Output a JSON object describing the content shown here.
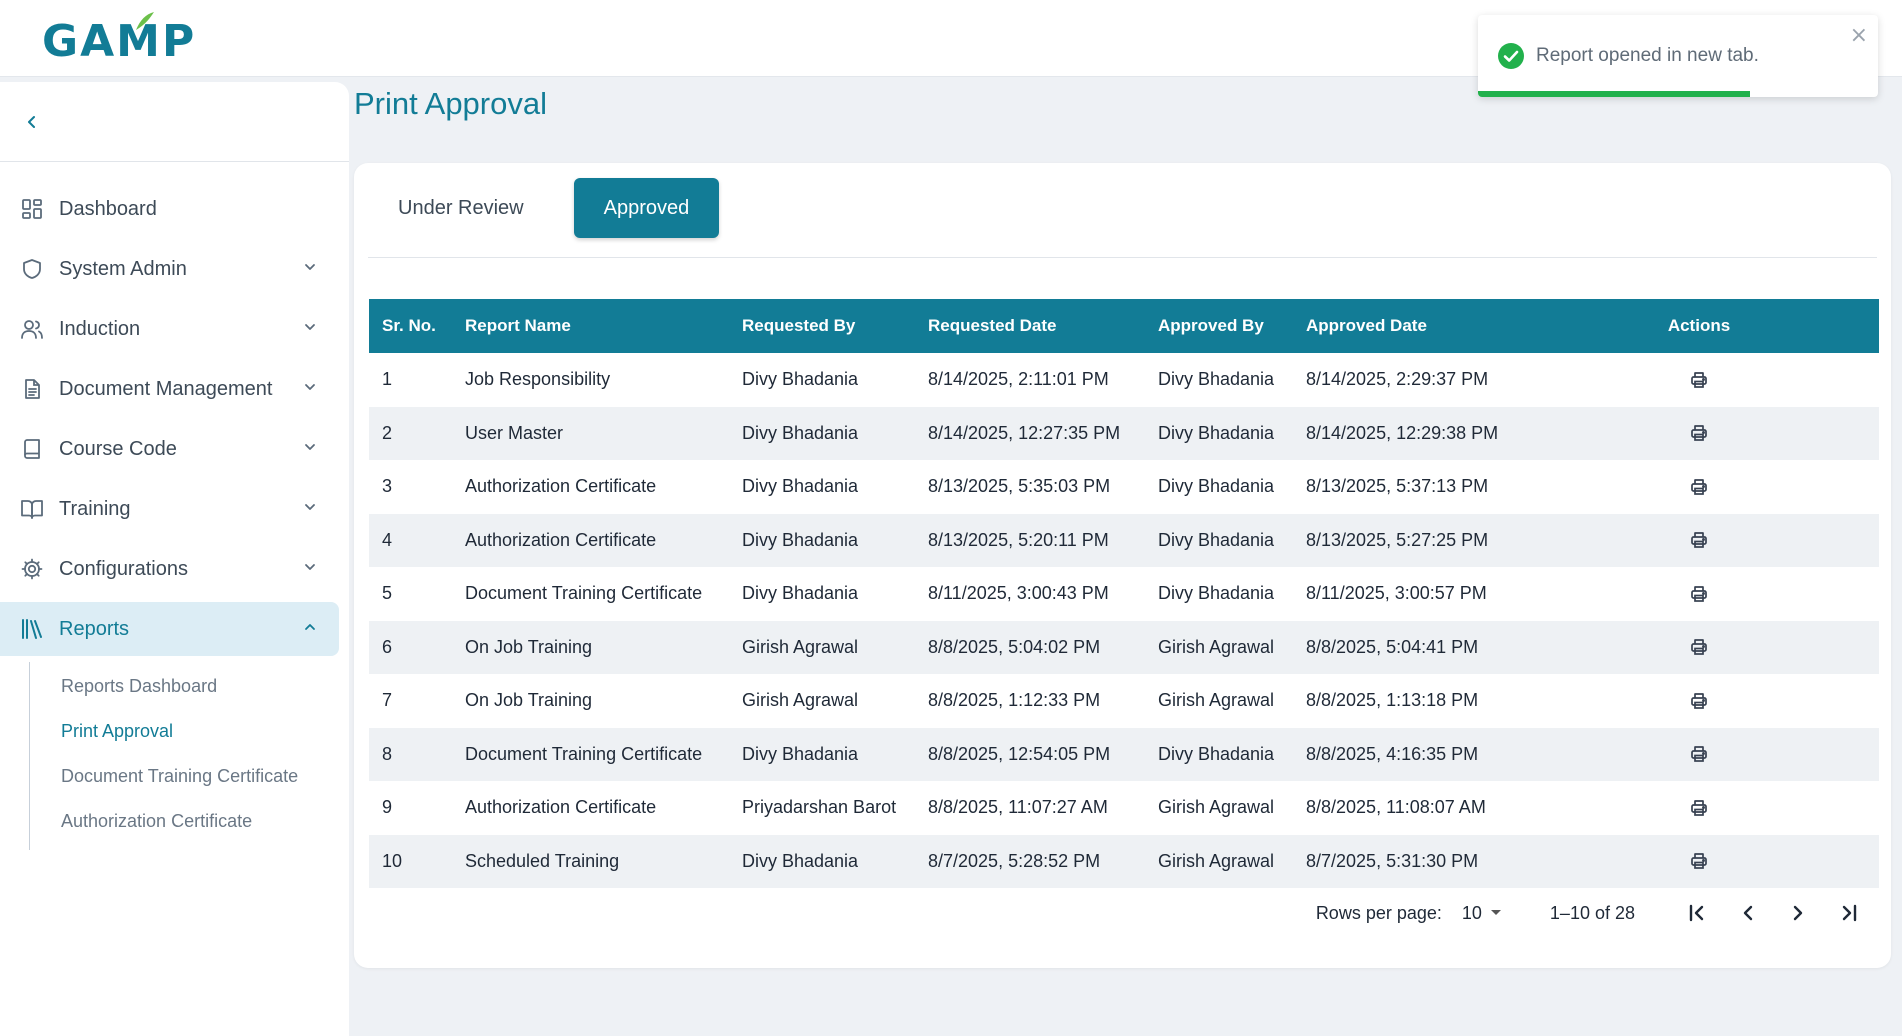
{
  "app": {
    "logo_text": "GAMP"
  },
  "sidebar": {
    "items": [
      {
        "label": "Dashboard",
        "icon": "dashboard-icon",
        "expandable": false
      },
      {
        "label": "System Admin",
        "icon": "shield-icon",
        "expandable": true
      },
      {
        "label": "Induction",
        "icon": "users-icon",
        "expandable": true
      },
      {
        "label": "Document Management",
        "icon": "document-icon",
        "expandable": true
      },
      {
        "label": "Course Code",
        "icon": "book-icon",
        "expandable": true
      },
      {
        "label": "Training",
        "icon": "open-book-icon",
        "expandable": true
      },
      {
        "label": "Configurations",
        "icon": "gear-icon",
        "expandable": true
      },
      {
        "label": "Reports",
        "icon": "library-icon",
        "expandable": true,
        "active": true
      }
    ],
    "subitems": [
      {
        "label": "Reports Dashboard"
      },
      {
        "label": "Print Approval",
        "active": true
      },
      {
        "label": "Document Training Certificate"
      },
      {
        "label": "Authorization Certificate"
      }
    ]
  },
  "page": {
    "title": "Print Approval"
  },
  "tabs": [
    {
      "label": "Under Review",
      "active": false
    },
    {
      "label": "Approved",
      "active": true
    }
  ],
  "table": {
    "columns": [
      "Sr. No.",
      "Report Name",
      "Requested By",
      "Requested Date",
      "Approved By",
      "Approved Date",
      "Actions"
    ],
    "rows": [
      [
        "1",
        "Job Responsibility",
        "Divy Bhadania",
        "8/14/2025, 2:11:01 PM",
        "Divy Bhadania",
        "8/14/2025, 2:29:37 PM"
      ],
      [
        "2",
        "User Master",
        "Divy Bhadania",
        "8/14/2025, 12:27:35 PM",
        "Divy Bhadania",
        "8/14/2025, 12:29:38 PM"
      ],
      [
        "3",
        "Authorization Certificate",
        "Divy Bhadania",
        "8/13/2025, 5:35:03 PM",
        "Divy Bhadania",
        "8/13/2025, 5:37:13 PM"
      ],
      [
        "4",
        "Authorization Certificate",
        "Divy Bhadania",
        "8/13/2025, 5:20:11 PM",
        "Divy Bhadania",
        "8/13/2025, 5:27:25 PM"
      ],
      [
        "5",
        "Document Training Certificate",
        "Divy Bhadania",
        "8/11/2025, 3:00:43 PM",
        "Divy Bhadania",
        "8/11/2025, 3:00:57 PM"
      ],
      [
        "6",
        "On Job Training",
        "Girish Agrawal",
        "8/8/2025, 5:04:02 PM",
        "Girish Agrawal",
        "8/8/2025, 5:04:41 PM"
      ],
      [
        "7",
        "On Job Training",
        "Girish Agrawal",
        "8/8/2025, 1:12:33 PM",
        "Girish Agrawal",
        "8/8/2025, 1:13:18 PM"
      ],
      [
        "8",
        "Document Training Certificate",
        "Divy Bhadania",
        "8/8/2025, 12:54:05 PM",
        "Divy Bhadania",
        "8/8/2025, 4:16:35 PM"
      ],
      [
        "9",
        "Authorization Certificate",
        "Priyadarshan Barot",
        "8/8/2025, 11:07:27 AM",
        "Girish Agrawal",
        "8/8/2025, 11:08:07 AM"
      ],
      [
        "10",
        "Scheduled Training",
        "Divy Bhadania",
        "8/7/2025, 5:28:52 PM",
        "Girish Agrawal",
        "8/7/2025, 5:31:30 PM"
      ]
    ],
    "row_action_icon": "printer-icon"
  },
  "pagination": {
    "rows_per_page_label": "Rows per page:",
    "rows_per_page_value": "10",
    "range_text": "1–10 of 28"
  },
  "toast": {
    "message": "Report opened in new tab.",
    "close_symbol": "×",
    "progress": 0.68
  },
  "colors": {
    "brand": "#127c96",
    "success": "#22b14c",
    "logo_leaf": "#6cc04a"
  }
}
